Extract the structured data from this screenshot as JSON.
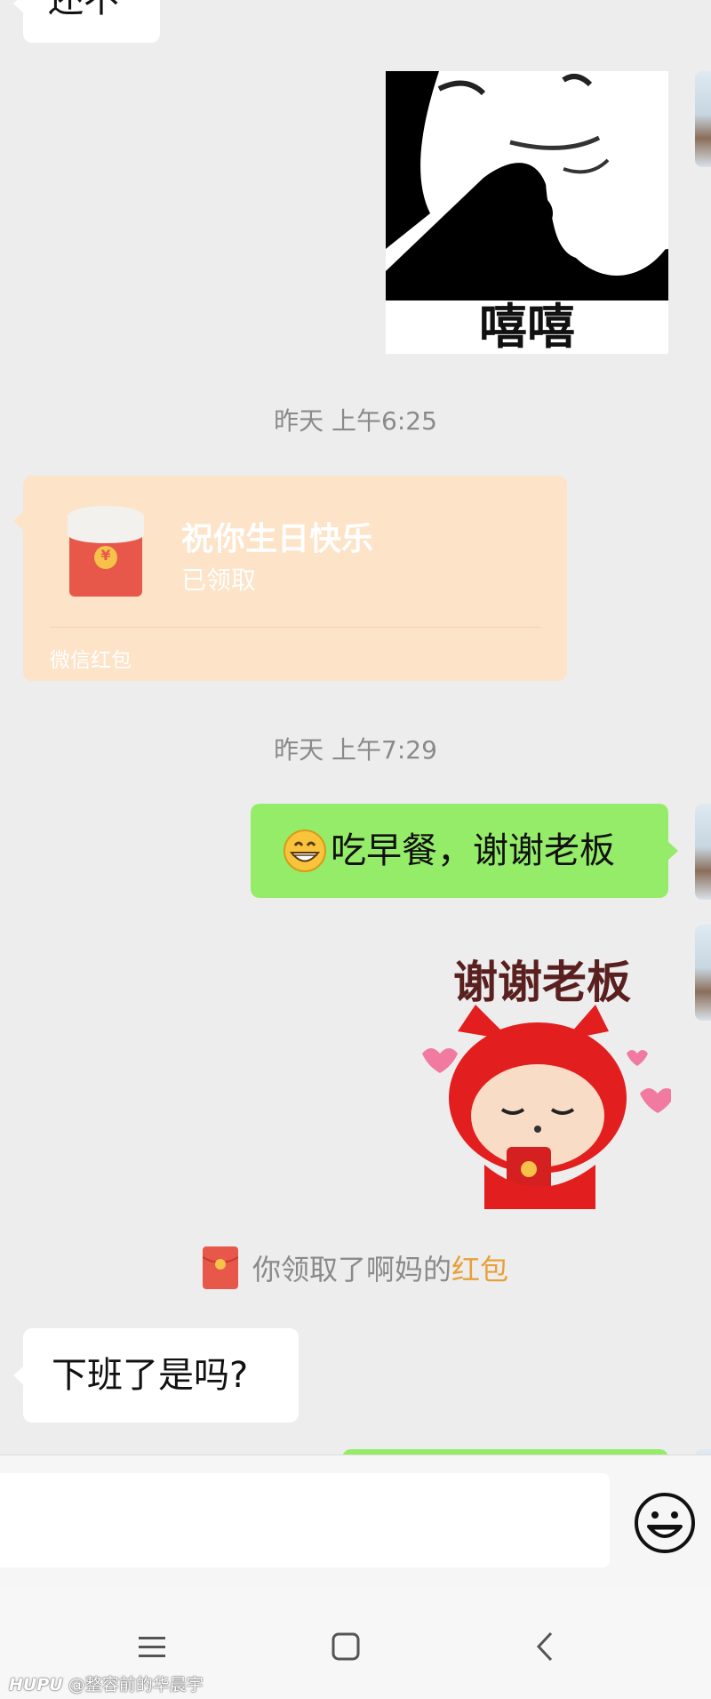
{
  "messages": {
    "top_partial_text": "还不",
    "sticker_xixi_text": "嘻嘻",
    "time1": "昨天 上午6:25",
    "redpacket": {
      "greeting": "祝你生日快乐",
      "status": "已领取",
      "footer": "微信红包",
      "yuan_symbol": "¥"
    },
    "time2": "昨天 上午7:29",
    "reply_text": "吃早餐，谢谢老板",
    "reply_emoji": "grinning-face-icon",
    "sticker_thanks_text": "谢谢老板",
    "system_notice": {
      "prefix": "你领取了啊妈的",
      "link": "红包"
    },
    "question_text": "下班了是吗?"
  },
  "watermark": {
    "brand": "HUPU",
    "author": "@整容前的华晨宇"
  },
  "colors": {
    "chat_bg": "#ededed",
    "outgoing_bubble": "#95ec69",
    "incoming_bubble": "#ffffff",
    "redpacket_bg": "#fde3c8",
    "redpacket_red": "#e8584a",
    "link_orange": "#e8a03a"
  }
}
